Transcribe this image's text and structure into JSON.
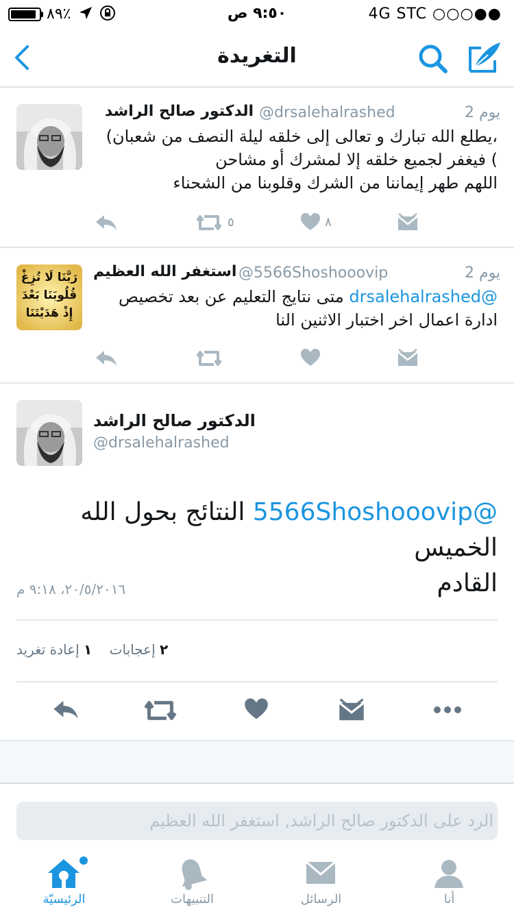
{
  "status_bar": {
    "battery_percent": "٨٩٪",
    "battery_level": 0.89,
    "time": "٩:٥٠ ص",
    "network": "4G  STC ○○○●●"
  },
  "nav": {
    "title": "التغريدة",
    "icons": [
      "back-chevron-icon",
      "search-icon",
      "compose-icon"
    ]
  },
  "timeline": [
    {
      "name": "الدكتور صالح الراشد",
      "handle": "@drsalehalrashed",
      "time": "2 يوم",
      "lines": [
        "(يطلع الله تبارك و تعالى إلى خلقه ليلة النصف من شعبان،",
        "فيغفر لجميع خلقه إلا لمشرك أو مشاحن (",
        "اللهم طهر إيماننا من الشرك وقلوبنا من الشحناء"
      ],
      "retweets": "٥",
      "likes": "٨"
    },
    {
      "name": "استغفر الله العظيم",
      "handle": "@5566Shoshooovip",
      "time": "2 يوم",
      "mention": "@drsalehalrashed",
      "line1_rest": "متى نتايج التعليم عن بعد تخصيص",
      "line2": "ادارة اعمال اخر اختبار الاثنين النا",
      "avatar_text": "رَبَّنَا لَا تُزِغْ قُلُوبَنَا بَعْدَ إِذْ هَدَيْتَنَا"
    }
  ],
  "detail": {
    "name": "الدكتور صالح الراشد",
    "handle": "@drsalehalrashed",
    "mention": "@5566Shoshooovip",
    "text_line1": "النتائج بحول الله الخميس",
    "text_line2": "القادم",
    "datetime": "٢٠/٥/٢٠١٦، ٩:١٨ م",
    "likes_count": "٢",
    "likes_label": "إعجابات",
    "retweets_count": "١",
    "retweets_label": "إعادة تغريد"
  },
  "reply": {
    "placeholder": "الرد على الدكتور صالح الراشد, استغفر الله العظيم"
  },
  "tabs": [
    {
      "label": "الرئيسيّة",
      "icon": "home-icon",
      "active": true
    },
    {
      "label": "التنبيهات",
      "icon": "bell-icon",
      "active": false
    },
    {
      "label": "الرسائل",
      "icon": "envelope-icon",
      "active": false
    },
    {
      "label": "أنا",
      "icon": "person-icon",
      "active": false
    }
  ],
  "colors": {
    "accent": "#1b95e0",
    "icon_gray": "#aab8c2",
    "detail_icon_gray": "#657786",
    "muted_text": "#8899a6"
  }
}
